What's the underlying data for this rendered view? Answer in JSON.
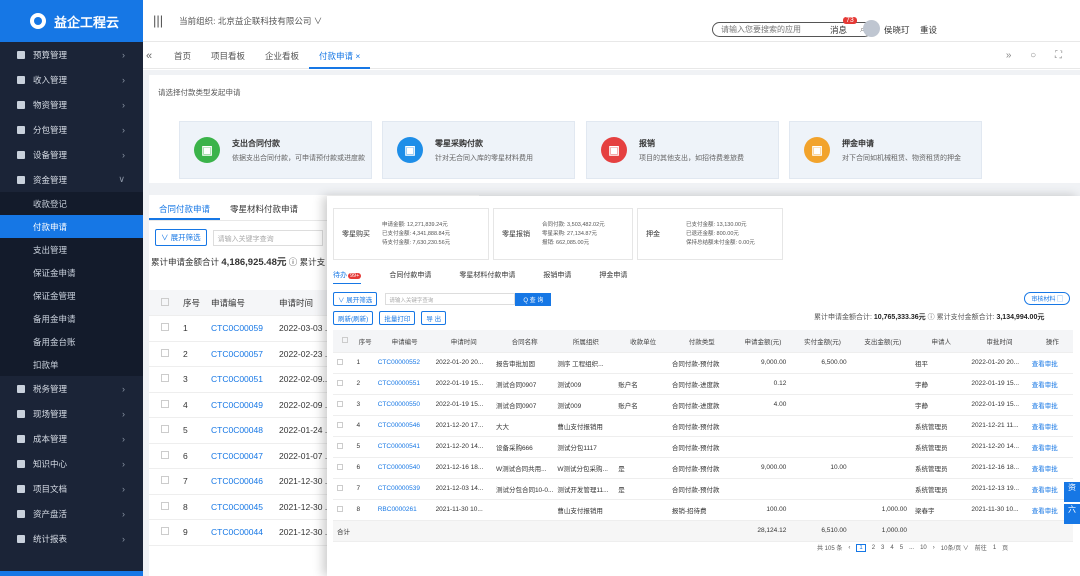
{
  "app": {
    "logo_text": "益企工程云"
  },
  "sidebar": {
    "items": [
      {
        "label": "预算管理"
      },
      {
        "label": "收入管理"
      },
      {
        "label": "物资管理"
      },
      {
        "label": "分包管理"
      },
      {
        "label": "设备管理"
      },
      {
        "label": "资金管理"
      }
    ],
    "sub_items": [
      {
        "label": "收款登记"
      },
      {
        "label": "付款申请"
      },
      {
        "label": "支出管理"
      },
      {
        "label": "保证金申请"
      },
      {
        "label": "保证金管理"
      },
      {
        "label": "备用金申请"
      },
      {
        "label": "备用金台账"
      },
      {
        "label": "扣款单"
      }
    ],
    "items_after": [
      {
        "label": "税务管理"
      },
      {
        "label": "现场管理"
      },
      {
        "label": "成本管理"
      },
      {
        "label": "知识中心"
      },
      {
        "label": "项目文档"
      },
      {
        "label": "资产盘活"
      },
      {
        "label": "统计报表"
      }
    ]
  },
  "topbar": {
    "org_label": "当前组织: 北京益企联科技有限公司 ∨",
    "search_placeholder": "请输入您要搜索的应用",
    "messages_label": "消息",
    "messages_count": "73",
    "user_name": "侯晓玎",
    "exit_label": "重设"
  },
  "tabs": [
    {
      "label": "首页"
    },
    {
      "label": "项目看板"
    },
    {
      "label": "企业看板"
    },
    {
      "label": "付款申请 ×"
    }
  ],
  "panel": {
    "hint": "请选择付款类型发起申请",
    "cards": [
      {
        "title": "支出合同付款",
        "desc": "依据支出合同付款，可申请预付款或进度款",
        "color": "#3bb34a",
        "icon": "contract-icon"
      },
      {
        "title": "零星采购付款",
        "desc": "针对无合同入库的零星材料费用",
        "color": "#1e8ee8",
        "icon": "cart-icon"
      },
      {
        "title": "报销",
        "desc": "项目的其他支出，如招待费差旅费",
        "color": "#e54040",
        "icon": "receipt-icon"
      },
      {
        "title": "押金申请",
        "desc": "对下合同如机械租赁、物资租赁的押金",
        "color": "#f2a32c",
        "icon": "deposit-icon"
      }
    ]
  },
  "list_panel": {
    "tabs": [
      {
        "label": "合同付款申请"
      },
      {
        "label": "零星材料付款申请"
      }
    ],
    "expand_filter": "∨ 展开筛选",
    "keyword_placeholder": "请输入关键字查询",
    "total_label": "累计申请金额合计",
    "total_value": "4,186,925.48元",
    "total_suffix": "ⓘ  累计支",
    "headers": {
      "seq": "序号",
      "code": "申请编号",
      "time": "申请时间"
    },
    "rows": [
      {
        "seq": "1",
        "code": "CTC0C00059",
        "time": "2022-03-03 ..."
      },
      {
        "seq": "2",
        "code": "CTC0C00057",
        "time": "2022-02-23 ..."
      },
      {
        "seq": "3",
        "code": "CTC0C00051",
        "time": "2022-02-09..."
      },
      {
        "seq": "4",
        "code": "CTC0C00049",
        "time": "2022-02-09 ..."
      },
      {
        "seq": "5",
        "code": "CTC0C00048",
        "time": "2022-01-24 ..."
      },
      {
        "seq": "6",
        "code": "CTC0C00047",
        "time": "2022-01-07 ..."
      },
      {
        "seq": "7",
        "code": "CTC0C00046",
        "time": "2021-12-30 ..."
      },
      {
        "seq": "8",
        "code": "CTC0C00045",
        "time": "2021-12-30 ..."
      },
      {
        "seq": "9",
        "code": "CTC0C00044",
        "time": "2021-12-30 ..."
      }
    ]
  },
  "overlay": {
    "stats": [
      {
        "label": "零星购买",
        "lines": [
          "申请金额: 12,271,839.24元",
          "已支付金额: 4,341,888.84元",
          "待支付金额: 7,630,230.56元"
        ]
      },
      {
        "label": "零星报销",
        "lines": [
          "合同付款: 3,503,482.02元",
          "零星采购: 27,134.87元",
          "报销: 662,085.00元"
        ]
      },
      {
        "label": "押金",
        "lines": [
          "已支付金额: 13,130.00元",
          "已退还金额: 800.00元",
          "保持总结额未付金额: 0.00元"
        ]
      }
    ],
    "tabs": [
      {
        "label": "待办",
        "badge": "99+"
      },
      {
        "label": "合同付款申请"
      },
      {
        "label": "零星材料付款申请"
      },
      {
        "label": "报销申请"
      },
      {
        "label": "押金申请"
      }
    ],
    "expand_filter": "∨ 展开筛选",
    "search_placeholder": "请输入关键字查询",
    "search_button": "Q 查 询",
    "right_button": "审核材料 ▢",
    "btn_refresh": "刷新(刷新)",
    "btn_batch": "批量打印",
    "btn_export": "导 出",
    "sum_apply_label": "累计申请金额合计:",
    "sum_apply_value": "10,765,333.36元",
    "sum_paid_label": "ⓘ  累计支付金额合计:",
    "sum_paid_value": "3,134,994.00元",
    "headers": [
      "序号",
      "申请编号",
      "申请时间",
      "合同名称",
      "所属组织",
      "收款单位",
      "付款类型",
      "申请金额(元)",
      "实付金额(元)",
      "支出金额(元)",
      "申请人",
      "审批时间",
      "操作"
    ],
    "rows": [
      [
        "1",
        "CTC00000552",
        "2022-01-20 20...",
        "报告审批加固",
        "测序 工程组织...",
        "",
        "合同付款-预付款",
        "9,000.00",
        "6,500.00",
        "",
        "祖平",
        "2022-01-20 20...",
        "查看审批"
      ],
      [
        "2",
        "CTC00000551",
        "2022-01-19 15...",
        "测试合同0907",
        "测试009",
        "账户名",
        "合同付款-进度款",
        "0.12",
        "",
        "",
        "宇静",
        "2022-01-19 15...",
        "查看审批"
      ],
      [
        "3",
        "CTC00000550",
        "2022-01-19 15...",
        "测试合同0907",
        "测试009",
        "账户名",
        "合同付款-进度款",
        "4.00",
        "",
        "",
        "宇静",
        "2022-01-19 15...",
        "查看审批"
      ],
      [
        "4",
        "CTC00000546",
        "2021-12-20 17...",
        "大大",
        "曹山支付报销用",
        "",
        "合同付款-预付款",
        "",
        "",
        "",
        "系统管理员",
        "2021-12-21 11...",
        "查看审批"
      ],
      [
        "5",
        "CTC00000541",
        "2021-12-20 14...",
        "设备采购666",
        "测试分包1117",
        "",
        "合同付款-预付款",
        "",
        "",
        "",
        "系统管理员",
        "2021-12-20 14...",
        "查看审批"
      ],
      [
        "6",
        "CTC00000540",
        "2021-12-16 18...",
        "W测试合同共用...",
        "W测试分包采购...",
        "是",
        "合同付款-预付款",
        "9,000.00",
        "10.00",
        "",
        "系统管理员",
        "2021-12-16 18...",
        "查看审批"
      ],
      [
        "7",
        "CTC00000539",
        "2021-12-03 14...",
        "测试分包合同10-0...",
        "测试开发管理11...",
        "是",
        "合同付款-预付款",
        "",
        "",
        "",
        "系统管理员",
        "2021-12-13 19...",
        "查看审批"
      ],
      [
        "8",
        "RBC0000261",
        "2021-11-30 10...",
        "",
        "曹山支付报销用",
        "",
        "报销-招待费",
        "100.00",
        "",
        "1,000.00",
        "梁春宇",
        "2021-11-30 10...",
        "查看审批"
      ]
    ],
    "total_row": {
      "label": "合计",
      "apply": "28,124.12",
      "actual": "6,510.00",
      "expend": "1,000.00"
    },
    "pager": {
      "total": "共 105 条",
      "pages": [
        "1",
        "2",
        "3",
        "4",
        "5",
        "...",
        "10"
      ],
      "current": "1",
      "per_page": "10条/页 ∨",
      "goto": "前往",
      "goto_page": "1",
      "page_suffix": "页"
    }
  },
  "side_tabs": [
    {
      "label": "资"
    },
    {
      "label": "六"
    }
  ]
}
